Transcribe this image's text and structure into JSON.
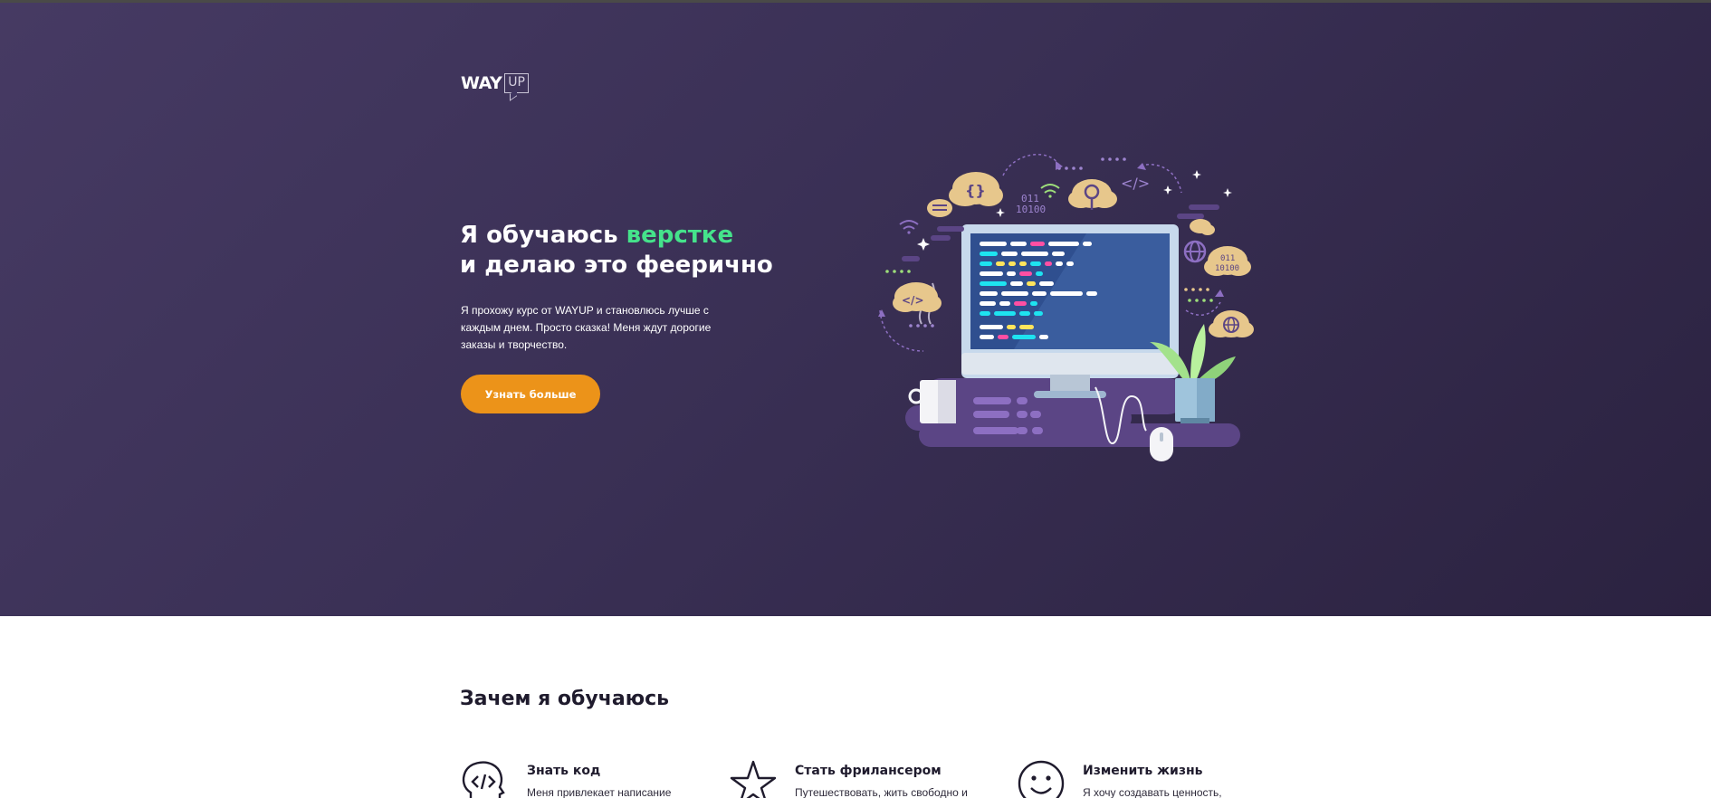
{
  "header": {
    "logo_way": "WAY",
    "logo_up": "UP"
  },
  "hero": {
    "title_part1": "Я обучаюсь ",
    "title_accent": "верстке",
    "title_line2": "и делаю это феерично",
    "description": "Я прохожу курс от WAYUP и становлюсь лучше с каждым днем. Просто сказка! Меня ждут дорогие заказы и творчество.",
    "cta_label": "Узнать больше",
    "illustration_texts": {
      "braces": "{}",
      "binary_short": "011",
      "binary_long": "10100",
      "code_tag": "</>"
    }
  },
  "reasons": {
    "title": "Зачем я обучаюсь",
    "items": [
      {
        "icon": "code-head-icon",
        "title": "Знать код",
        "text": "Меня привлекает написание"
      },
      {
        "icon": "star-icon",
        "title": "Стать фрилансером",
        "text": "Путешествовать, жить свободно и"
      },
      {
        "icon": "smile-icon",
        "title": "Изменить жизнь",
        "text": "Я хочу создавать ценность,"
      }
    ]
  },
  "colors": {
    "hero_bg": "#3a3055",
    "accent_green": "#45e38b",
    "cta_orange": "#ec9319",
    "text_dark": "#1f1b2d"
  }
}
